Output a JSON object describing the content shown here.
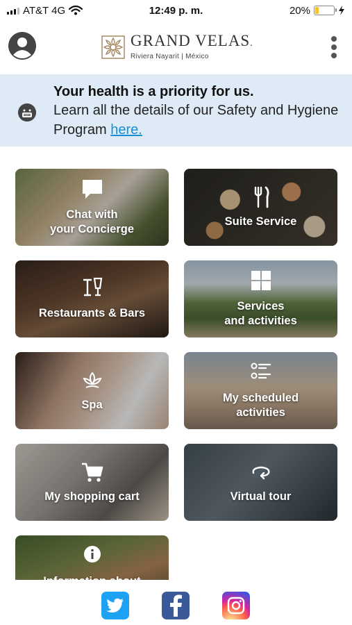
{
  "status_bar": {
    "carrier": "AT&T 4G",
    "time": "12:49 p. m.",
    "battery_percent": "20%",
    "battery_level": 0.2,
    "signal_bars": 3
  },
  "header": {
    "brand_name": "GRAND VELAS",
    "brand_trademark": ".",
    "brand_subtitle": "Riviera Nayarit | México",
    "profile_icon": "user-circle-icon",
    "menu_icon": "more-vertical-icon"
  },
  "banner": {
    "title": "Your health is a priority for us.",
    "body": "Learn all the details of our Safety and Hygiene Program",
    "link_text": "here.",
    "icon": "face-mask-icon"
  },
  "tiles": [
    {
      "label_line1": "Chat with",
      "label_line2": "your Concierge",
      "icon": "chat-bubble-icon"
    },
    {
      "label_line1": "Suite Service",
      "label_line2": "",
      "icon": "fork-knife-icon"
    },
    {
      "label_line1": "Restaurants & Bars",
      "label_line2": "",
      "icon": "cocktail-glass-icon"
    },
    {
      "label_line1": "Services",
      "label_line2": "and activities",
      "icon": "grid-squares-icon"
    },
    {
      "label_line1": "Spa",
      "label_line2": "",
      "icon": "lotus-icon"
    },
    {
      "label_line1": "My scheduled",
      "label_line2": "activities",
      "icon": "checklist-icon"
    },
    {
      "label_line1": "My shopping cart",
      "label_line2": "",
      "icon": "shopping-cart-icon"
    },
    {
      "label_line1": "Virtual tour",
      "label_line2": "",
      "icon": "rotate-360-icon"
    },
    {
      "label_line1": "Information about",
      "label_line2": "",
      "icon": "info-circle-icon"
    }
  ],
  "social": [
    {
      "name": "Twitter",
      "icon": "twitter-icon",
      "color": "#1da1f2"
    },
    {
      "name": "Facebook",
      "icon": "facebook-icon",
      "color": "#3b5998"
    },
    {
      "name": "Instagram",
      "icon": "instagram-icon",
      "color": "#d6249f"
    }
  ]
}
